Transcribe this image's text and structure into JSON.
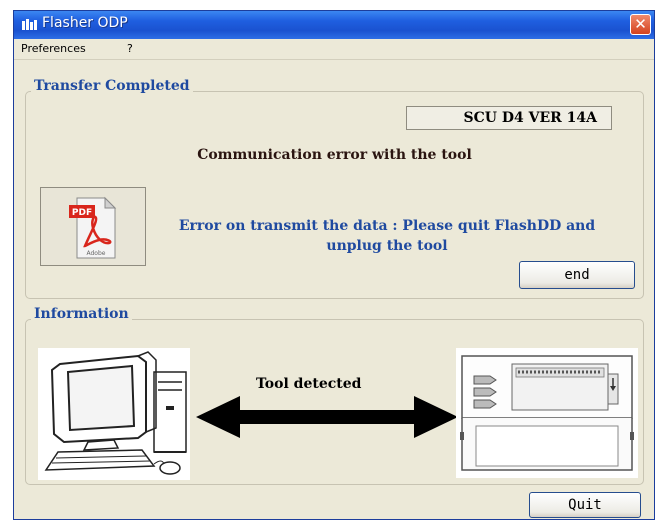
{
  "window": {
    "title": "Flasher ODP",
    "close_symbol": "✕"
  },
  "menu": {
    "items": [
      "Preferences",
      "?"
    ]
  },
  "transfer": {
    "group_title": "Transfer Completed",
    "version": "SCU D4 VER 14A",
    "comm_error": "Communication error with the tool",
    "error_line1": "Error on transmit the data : Please quit FlashDD and",
    "error_line2": "unplug the tool",
    "pdf_icon_label": "PDF",
    "pdf_brand": "Adobe",
    "end_button": "end"
  },
  "information": {
    "group_title": "Information",
    "status": "Tool detected"
  },
  "quit_button": "Quit",
  "icons": {
    "title": "flasher-app-icon",
    "close": "close-icon",
    "pdf": "pdf-document-icon",
    "computer": "computer-icon",
    "arrow": "double-arrow-icon",
    "tool": "diagnostic-tool-icon"
  },
  "colors": {
    "titlebar": "#1f5fe0",
    "group_title": "#1f4aa0",
    "error_text": "#1f4aa0",
    "close_button": "#d4421e"
  }
}
